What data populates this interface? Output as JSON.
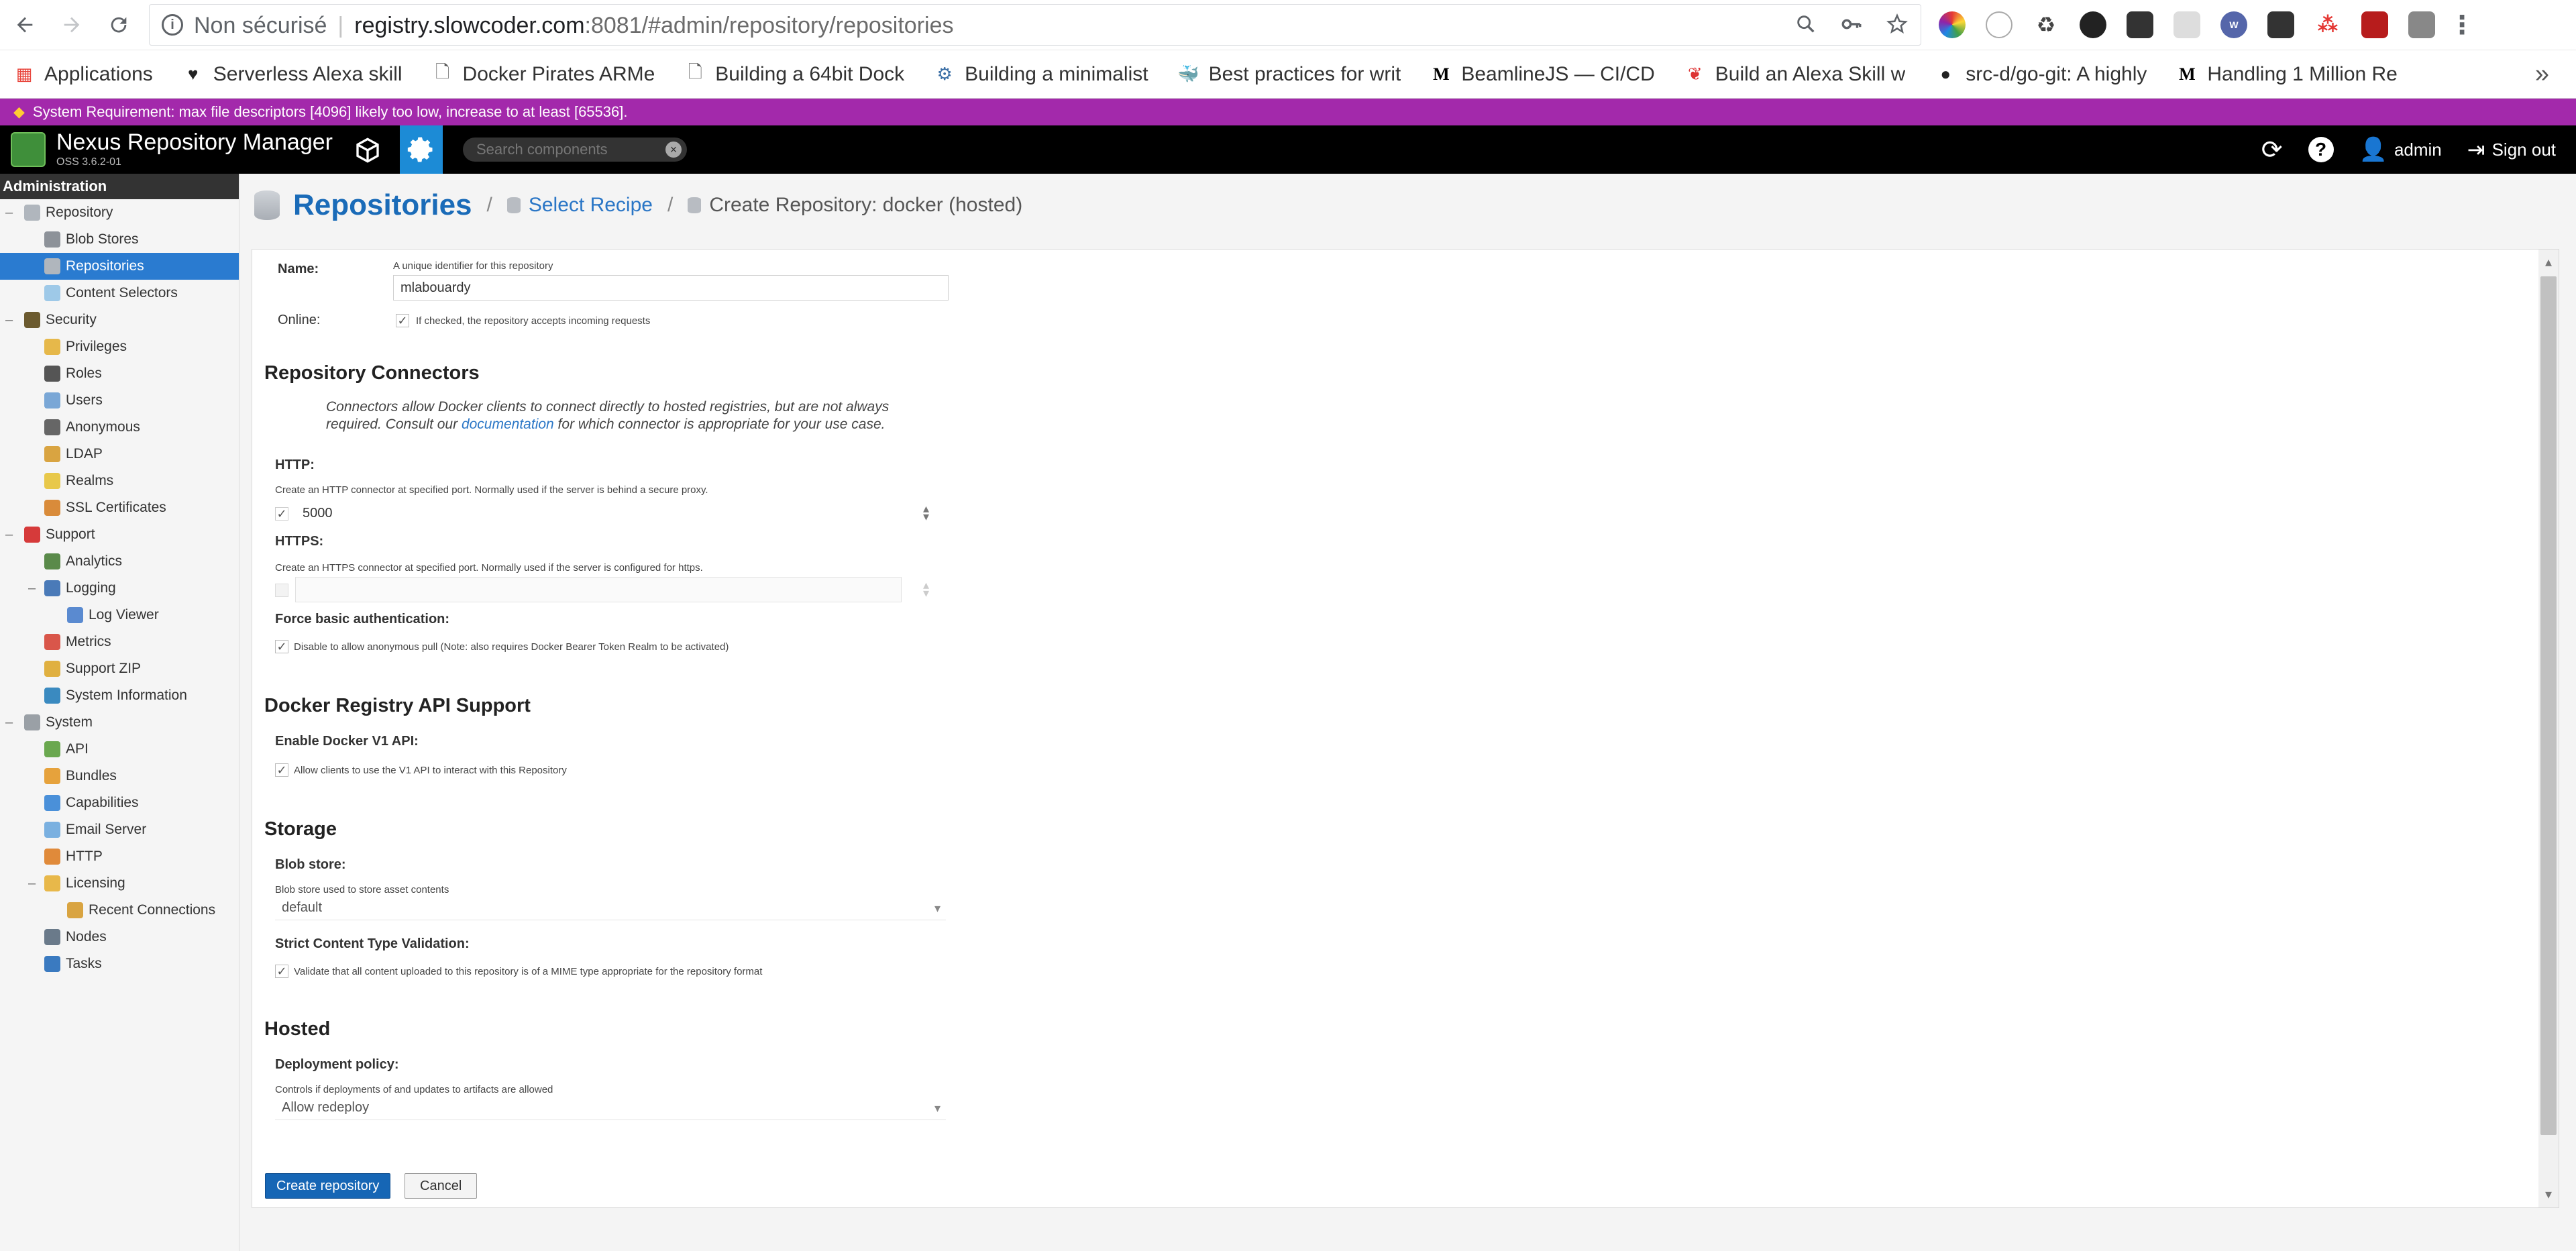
{
  "browser": {
    "insecure_label": "Non sécurisé",
    "url_host": "registry.slowcoder.com",
    "url_port_path": ":8081/#admin/repository/repositories"
  },
  "bookmarks": [
    {
      "label": "Applications",
      "icon": "apps-grid-icon"
    },
    {
      "label": "Serverless Alexa skill",
      "icon": "heart-icon"
    },
    {
      "label": "Docker Pirates ARMe",
      "icon": "page-icon"
    },
    {
      "label": "Building a 64bit Dock",
      "icon": "page-icon"
    },
    {
      "label": "Building a minimalist",
      "icon": "tools-icon"
    },
    {
      "label": "Best practices for writ",
      "icon": "docker-icon"
    },
    {
      "label": "BeamlineJS — CI/CD",
      "icon": "medium-icon"
    },
    {
      "label": "Build an Alexa Skill w",
      "icon": "leaf-icon"
    },
    {
      "label": "src-d/go-git: A highly",
      "icon": "github-icon"
    },
    {
      "label": "Handling 1 Million Re",
      "icon": "medium-icon"
    }
  ],
  "system_requirement": "System Requirement: max file descriptors [4096] likely too low, increase to at least [65536].",
  "nexus": {
    "title": "Nexus Repository Manager",
    "version": "OSS 3.6.2-01",
    "search_placeholder": "Search components",
    "user": "admin",
    "signout": "Sign out"
  },
  "sidebar": {
    "header": "Administration",
    "items": [
      {
        "label": "Repository",
        "level": 0,
        "toggle": "–",
        "icon_color": "#b0b6bd"
      },
      {
        "label": "Blob Stores",
        "level": 1,
        "icon_color": "#8d9299"
      },
      {
        "label": "Repositories",
        "level": 1,
        "icon_color": "#b0b6bd",
        "selected": true
      },
      {
        "label": "Content Selectors",
        "level": 1,
        "icon_color": "#9ec9e8"
      },
      {
        "label": "Security",
        "level": 0,
        "toggle": "–",
        "icon_color": "#6b5a2f"
      },
      {
        "label": "Privileges",
        "level": 1,
        "icon_color": "#e6b84a"
      },
      {
        "label": "Roles",
        "level": 1,
        "icon_color": "#555"
      },
      {
        "label": "Users",
        "level": 1,
        "icon_color": "#7aa7d6"
      },
      {
        "label": "Anonymous",
        "level": 1,
        "icon_color": "#666"
      },
      {
        "label": "LDAP",
        "level": 1,
        "icon_color": "#d9a441"
      },
      {
        "label": "Realms",
        "level": 1,
        "icon_color": "#e8c84a"
      },
      {
        "label": "SSL Certificates",
        "level": 1,
        "icon_color": "#d98b3a"
      },
      {
        "label": "Support",
        "level": 0,
        "toggle": "–",
        "icon_color": "#d63a3a"
      },
      {
        "label": "Analytics",
        "level": 1,
        "icon_color": "#5a8a4a"
      },
      {
        "label": "Logging",
        "level": 1,
        "toggle": "–",
        "icon_color": "#4a7ab8"
      },
      {
        "label": "Log Viewer",
        "level": 2,
        "icon_color": "#5a8ad0"
      },
      {
        "label": "Metrics",
        "level": 1,
        "icon_color": "#d9564a"
      },
      {
        "label": "Support ZIP",
        "level": 1,
        "icon_color": "#e0b040"
      },
      {
        "label": "System Information",
        "level": 1,
        "icon_color": "#3a8ac0"
      },
      {
        "label": "System",
        "level": 0,
        "toggle": "–",
        "icon_color": "#9aa0a6"
      },
      {
        "label": "API",
        "level": 1,
        "icon_color": "#6aa84f"
      },
      {
        "label": "Bundles",
        "level": 1,
        "icon_color": "#e6a23c"
      },
      {
        "label": "Capabilities",
        "level": 1,
        "icon_color": "#4a90d9"
      },
      {
        "label": "Email Server",
        "level": 1,
        "icon_color": "#7ab0e0"
      },
      {
        "label": "HTTP",
        "level": 1,
        "icon_color": "#e08a3a"
      },
      {
        "label": "Licensing",
        "level": 1,
        "toggle": "–",
        "icon_color": "#e8b84a"
      },
      {
        "label": "Recent Connections",
        "level": 2,
        "icon_color": "#d9a441"
      },
      {
        "label": "Nodes",
        "level": 1,
        "icon_color": "#6a7a8a"
      },
      {
        "label": "Tasks",
        "level": 1,
        "icon_color": "#3a7ac0"
      }
    ]
  },
  "breadcrumb": {
    "title": "Repositories",
    "step2": "Select Recipe",
    "step3": "Create Repository: docker (hosted)"
  },
  "form": {
    "name_label": "Name:",
    "name_help": "A unique identifier for this repository",
    "name_value": "mlabouardy",
    "online_label": "Online:",
    "online_check": "If checked, the repository accepts incoming requests",
    "connectors_title": "Repository Connectors",
    "connectors_desc_pre": "Connectors allow Docker clients to connect directly to hosted registries, but are not always required. Consult our ",
    "connectors_link": "documentation",
    "connectors_desc_post": " for which connector is appropriate for your use case.",
    "http_label": "HTTP:",
    "http_help": "Create an HTTP connector at specified port. Normally used if the server is behind a secure proxy.",
    "http_value": "5000",
    "https_label": "HTTPS:",
    "https_help": "Create an HTTPS connector at specified port. Normally used if the server is configured for https.",
    "force_label": "Force basic authentication:",
    "force_check": "Disable to allow anonymous pull (Note: also requires Docker Bearer Token Realm to be activated)",
    "api_title": "Docker Registry API Support",
    "v1_label": "Enable Docker V1 API:",
    "v1_check": "Allow clients to use the V1 API to interact with this Repository",
    "storage_title": "Storage",
    "blob_label": "Blob store:",
    "blob_help": "Blob store used to store asset contents",
    "blob_value": "default",
    "strict_label": "Strict Content Type Validation:",
    "strict_check": "Validate that all content uploaded to this repository is of a MIME type appropriate for the repository format",
    "hosted_title": "Hosted",
    "deploy_label": "Deployment policy:",
    "deploy_help": "Controls if deployments of and updates to artifacts are allowed",
    "deploy_value": "Allow redeploy",
    "create_button": "Create repository",
    "cancel_button": "Cancel"
  }
}
